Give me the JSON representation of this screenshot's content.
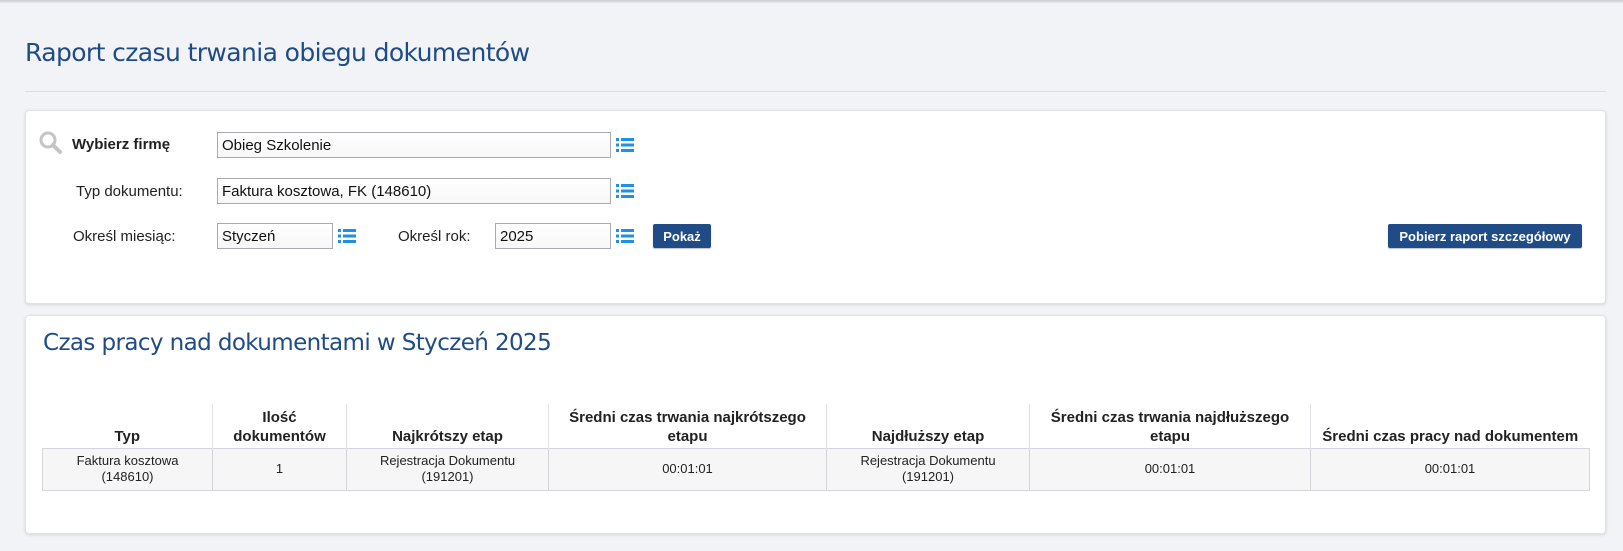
{
  "page": {
    "title": "Raport czasu trwania obiegu dokumentów"
  },
  "filters": {
    "company_label": "Wybierz firmę",
    "company_value": "Obieg Szkolenie",
    "doc_type_label": "Typ dokumentu:",
    "doc_type_value": "Faktura kosztowa, FK (148610)",
    "month_label": "Określ miesiąc:",
    "month_value": "Styczeń",
    "year_label": "Określ rok:",
    "year_value": "2025",
    "show_button": "Pokaż",
    "download_button": "Pobierz raport szczegółowy"
  },
  "report": {
    "title_prefix": "Czas pracy nad dokumentami w",
    "title_month": "Styczeń",
    "title_year": "2025",
    "columns": [
      "Typ",
      "Ilość dokumentów",
      "Najkrótszy etap",
      "Średni czas trwania najkrótszego etapu",
      "Najdłuższy etap",
      "Średni czas trwania najdłuższego etapu",
      "Średni czas pracy nad dokumentem"
    ],
    "rows": [
      [
        "Faktura kosztowa (148610)",
        "1",
        "Rejestracja Dokumentu (191201)",
        "00:01:01",
        "Rejestracja Dokumentu (191201)",
        "00:01:01",
        "00:01:01"
      ]
    ]
  },
  "colors": {
    "brand": "#1f4c87",
    "icon": "#1e90e6",
    "search_icon": "#c4c4c4"
  },
  "icons": {
    "search": "search-icon",
    "list": "list-icon"
  }
}
